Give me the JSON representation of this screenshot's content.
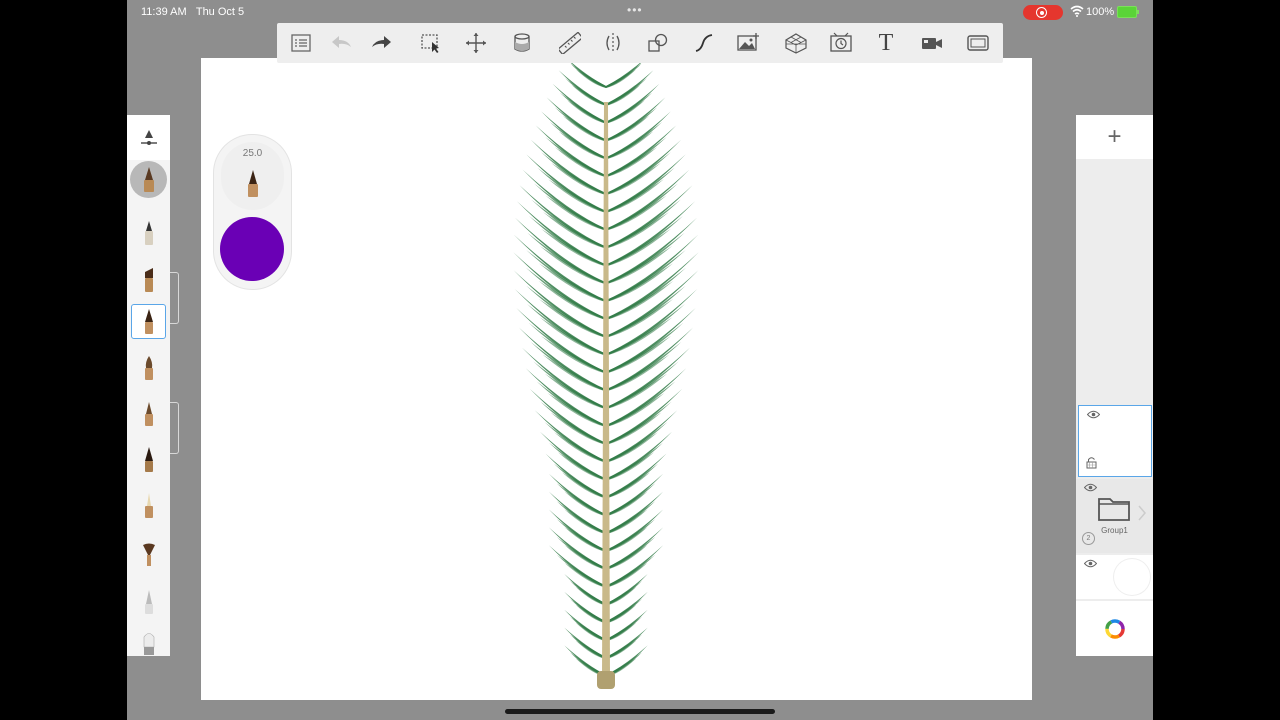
{
  "status_bar": {
    "time": "11:39 AM",
    "date": "Thu Oct 5",
    "multitask_dots": "•••",
    "battery_percent": "100%",
    "recording_color": "#e5362e",
    "battery_color": "#5ad438"
  },
  "toolbar": {
    "items": [
      {
        "name": "list-icon"
      },
      {
        "name": "undo-icon"
      },
      {
        "name": "redo-icon"
      },
      {
        "name": "selection-icon"
      },
      {
        "name": "transform-icon"
      },
      {
        "name": "fill-icon"
      },
      {
        "name": "ruler-icon"
      },
      {
        "name": "symmetry-icon"
      },
      {
        "name": "shapes-icon"
      },
      {
        "name": "curve-icon"
      },
      {
        "name": "import-image-icon"
      },
      {
        "name": "perspective-icon"
      },
      {
        "name": "time-lapse-icon"
      },
      {
        "name": "text-icon"
      },
      {
        "name": "video-icon"
      },
      {
        "name": "fullscreen-icon"
      }
    ],
    "text_tool_glyph": "T"
  },
  "brush_puck": {
    "size_value": "25.0",
    "current_color": "#6a00b5"
  },
  "brush_palette": {
    "selected_index": 2,
    "brushes": [
      {
        "name": "brush-pencil"
      },
      {
        "name": "brush-marker"
      },
      {
        "name": "brush-ink"
      },
      {
        "name": "brush-paint"
      },
      {
        "name": "brush-pen"
      },
      {
        "name": "brush-dark-pen"
      },
      {
        "name": "brush-nib"
      },
      {
        "name": "brush-fan"
      },
      {
        "name": "brush-airbrush"
      },
      {
        "name": "brush-soft"
      }
    ]
  },
  "layers": {
    "add_label": "+",
    "items": [
      {
        "kind": "layer",
        "selected": true
      },
      {
        "kind": "group",
        "name": "Group1",
        "count": "2"
      },
      {
        "kind": "background"
      }
    ]
  },
  "canvas": {
    "background": "#ffffff",
    "artwork": "palm-frond",
    "leaf_color": "#2f7a45",
    "stem_color": "#c9b98a"
  }
}
